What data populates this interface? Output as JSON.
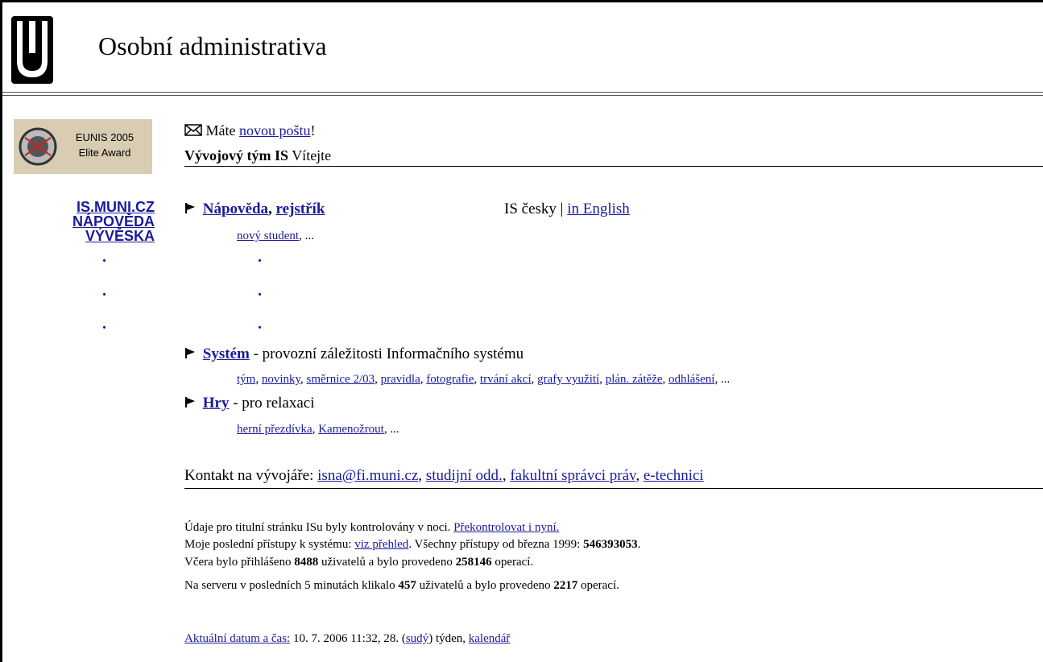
{
  "header": {
    "title": "Osobní administrativa"
  },
  "award": {
    "line1": "EUNIS 2005",
    "line2": "Elite Award"
  },
  "mail": {
    "prefix": "Máte",
    "link": "novou poštu",
    "suffix": "!"
  },
  "welcome": {
    "team": "Vývojový tým IS",
    "greeting": "Vítejte"
  },
  "sidebar": {
    "items": [
      "IS.MUNI.CZ",
      "NÁPOVĚDA",
      "VÝVĚSKA"
    ]
  },
  "help": {
    "title1": "Nápověda",
    "sep": ",",
    "title2": "rejstřík",
    "links": [
      "nový student"
    ],
    "ellipsis": "..."
  },
  "language": {
    "current": "IS česky |",
    "english": "in English"
  },
  "dots": [
    ".",
    ".",
    ".",
    ".",
    ".",
    "."
  ],
  "system": {
    "title": "Systém",
    "desc": "- provozní záležitosti Informačního systému",
    "links": [
      "tým",
      "novinky",
      "směrnice 2/03",
      "pravidla",
      "fotografie",
      "trvání akcí",
      "grafy využití",
      "plán. zátěže",
      "odhlášení"
    ],
    "ellipsis": "..."
  },
  "games": {
    "title": "Hry",
    "desc": "- pro relaxaci",
    "links": [
      "herní přezdívka",
      "Kamenožrout"
    ],
    "ellipsis": "..."
  },
  "contact": {
    "label": "Kontakt na vývojáře:",
    "links": [
      "isna@fi.muni.cz",
      "studijní odd.",
      "fakultní správci práv",
      "e-technici"
    ]
  },
  "info": {
    "line1_text": "Údaje pro titulní stránku ISu byly kontrolovány v noci.",
    "line1_link": "Překontrolovat i nyní.",
    "line2_text": "Moje poslední přístupy k systému:",
    "line2_link": "viz přehled",
    "line2_rest": ". Všechny přístupy od března 1999:",
    "total_access": "546393053",
    "line3_a": "Včera bylo přihlášeno",
    "users_yesterday": "8488",
    "line3_b": "uživatelů a bylo provedeno",
    "ops_yesterday": "258146",
    "line3_c": "operací.",
    "line4_a": "Na serveru v posledních 5 minutách klikalo",
    "users_5min": "457",
    "line4_b": "uživatelů a bylo provedeno",
    "ops_5min": "2217",
    "line4_c": "operací."
  },
  "datetime": {
    "link": "Aktuální datum a čas:",
    "value": "10. 7. 2006 11:32, 28.",
    "week_parity": "sudý",
    "week_label": "týden",
    "calendar": "kalendář"
  }
}
